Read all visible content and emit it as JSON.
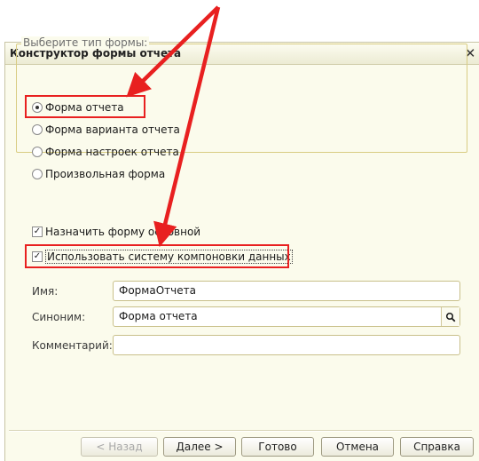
{
  "dialog": {
    "title": "Конструктор формы отчета",
    "close_symbol": "✕"
  },
  "form_type": {
    "legend": "Выберите тип формы:",
    "options": [
      {
        "label": "Форма отчета",
        "checked": true
      },
      {
        "label": "Форма варианта отчета",
        "checked": false
      },
      {
        "label": "Форма настроек отчета",
        "checked": false
      },
      {
        "label": "Произвольная форма",
        "checked": false
      }
    ]
  },
  "checkboxes": [
    {
      "label": "Назначить форму основной",
      "checked": true
    },
    {
      "label": "Использовать систему компоновки данных",
      "checked": true
    }
  ],
  "fields": {
    "name": {
      "label": "Имя:",
      "value": "ФормаОтчета"
    },
    "synonym": {
      "label": "Синоним:",
      "value": "Форма отчета"
    },
    "comment": {
      "label": "Комментарий:",
      "value": ""
    }
  },
  "buttons": {
    "back": "< Назад",
    "next": "Далее >",
    "finish": "Готово",
    "cancel": "Отмена",
    "help": "Справка"
  },
  "annotation_colors": {
    "arrow": "#e82020",
    "highlight": "#e82020"
  }
}
